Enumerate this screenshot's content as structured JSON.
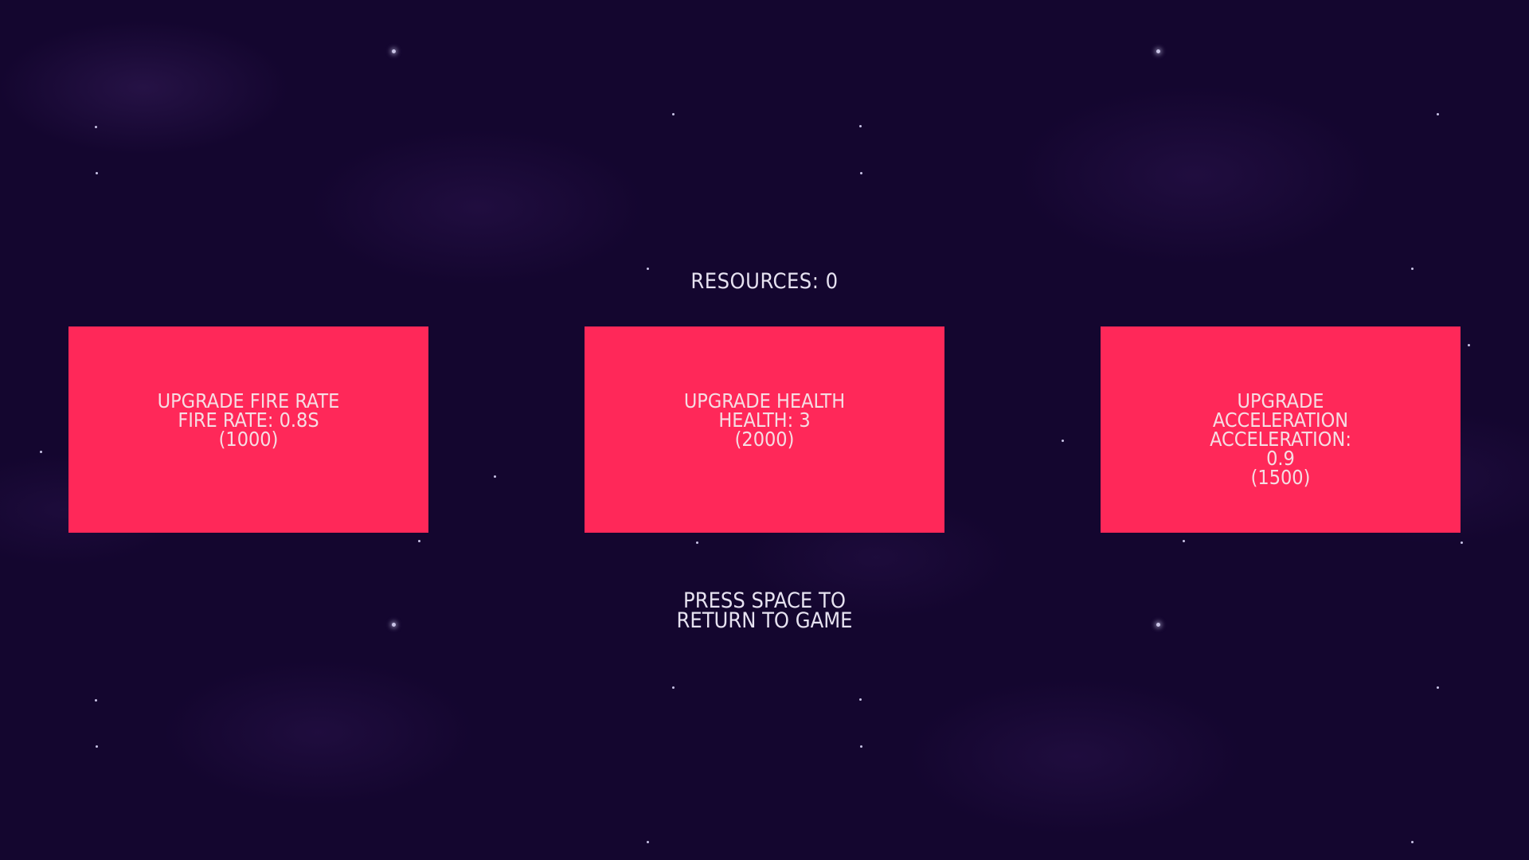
{
  "hud": {
    "resources_label": "RESOURCES: 0"
  },
  "upgrades": [
    {
      "title": "UPGRADE FIRE RATE",
      "stat": "FIRE RATE: 0.8S",
      "cost": "(1000)"
    },
    {
      "title": "UPGRADE HEALTH",
      "stat": "HEALTH: 3",
      "cost": "(2000)"
    },
    {
      "title": "UPGRADE ACCELERATION",
      "stat": "ACCELERATION: 0.9",
      "cost": "(1500)"
    }
  ],
  "prompt": {
    "line1": "PRESS SPACE TO",
    "line2": "RETURN TO GAME"
  },
  "colors": {
    "background": "#14062f",
    "card": "#ff2859",
    "card_text": "#f6dde3",
    "hud_text": "#e6e2f0"
  }
}
